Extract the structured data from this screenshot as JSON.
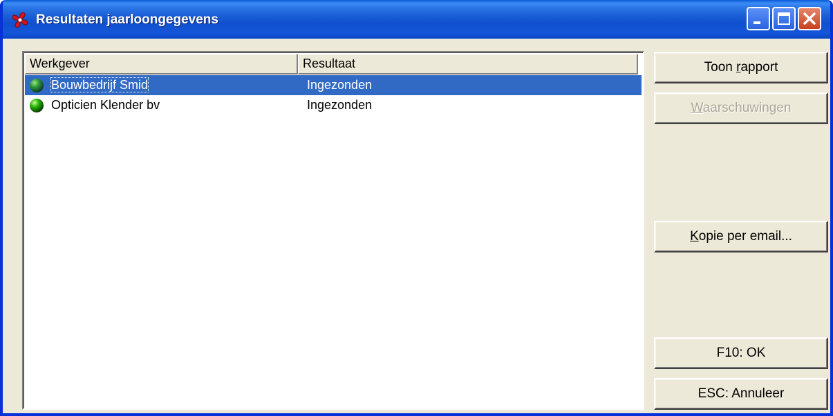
{
  "window": {
    "title": "Resultaten jaarloongegevens",
    "app_icon": "red-swirl-icon",
    "controls": {
      "minimize": "minimize-icon",
      "maximize": "maximize-icon",
      "close": "close-icon"
    }
  },
  "list": {
    "columns": [
      "Werkgever",
      "Resultaat"
    ],
    "rows": [
      {
        "werkgever": "Bouwbedrijf Smid",
        "resultaat": "Ingezonden",
        "status_icon": "green-ball-icon",
        "selected": true
      },
      {
        "werkgever": "Opticien Klender bv",
        "resultaat": "Ingezonden",
        "status_icon": "green-ball-icon",
        "selected": false
      }
    ]
  },
  "buttons": {
    "toon_rapport": {
      "before": "Toon ",
      "mnemonic": "r",
      "after": "apport",
      "enabled": true
    },
    "waarschuwingen": {
      "before": "",
      "mnemonic": "W",
      "after": "aarschuwingen",
      "enabled": false
    },
    "kopie_email": {
      "before": "",
      "mnemonic": "K",
      "after": "opie per email...",
      "enabled": true
    },
    "ok": {
      "label": "F10: OK",
      "enabled": true
    },
    "annuleer": {
      "label": "ESC: Annuleer",
      "enabled": true
    }
  },
  "colors": {
    "titlebar": "#0a5bd6",
    "selection": "#316ac5",
    "face": "#ece9d8",
    "disabled_text": "#aca899",
    "status_green": "#22b400"
  }
}
